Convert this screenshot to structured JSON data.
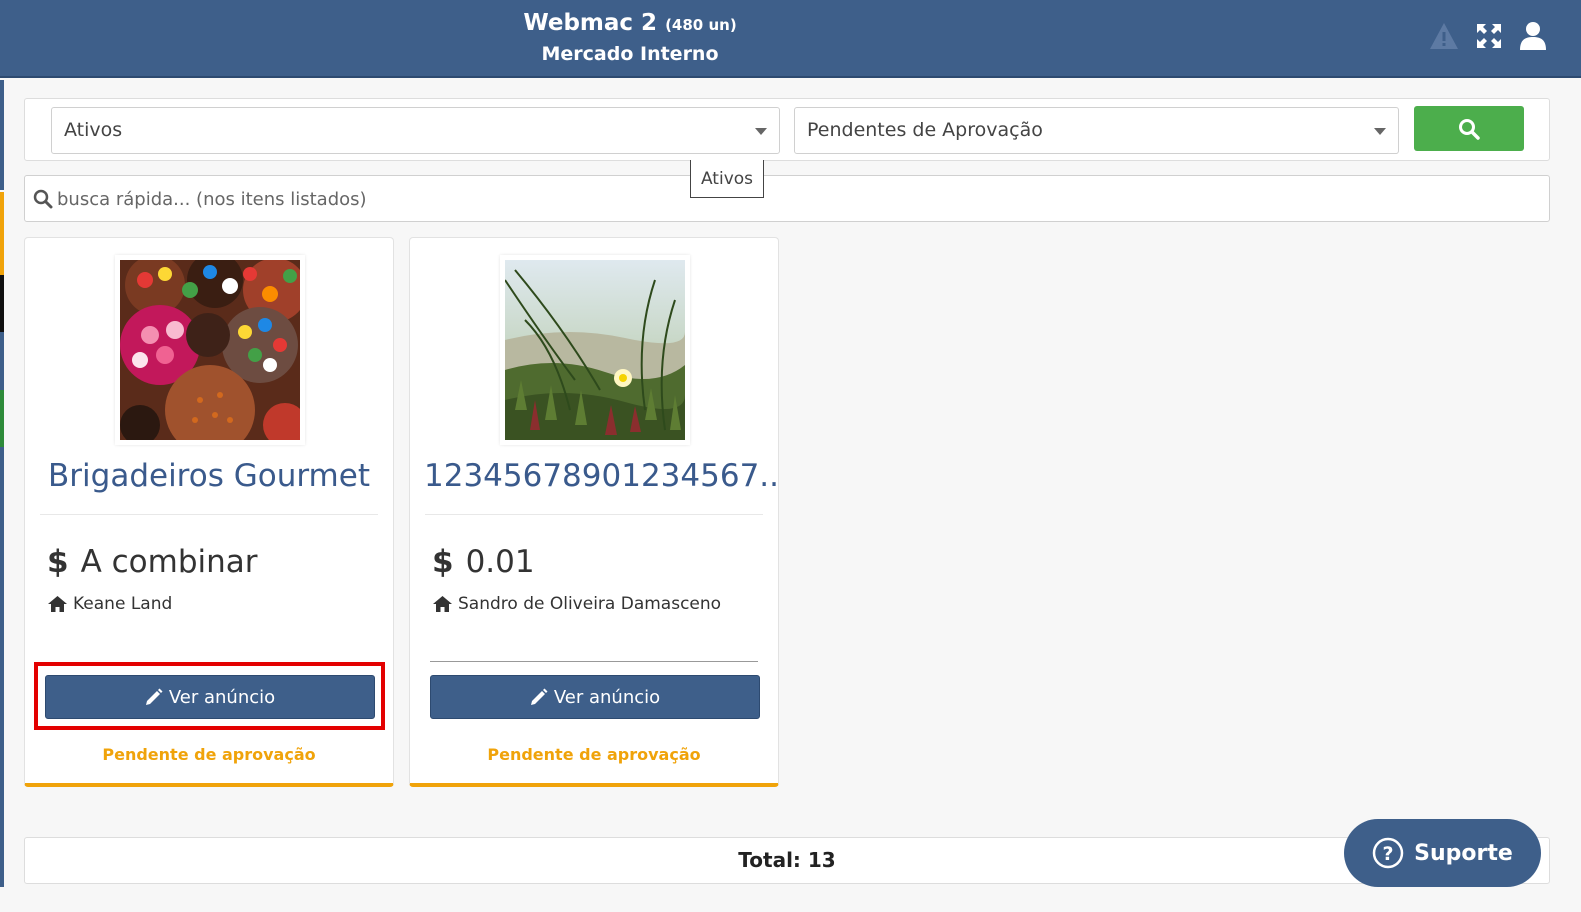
{
  "header": {
    "title": "Webmac 2",
    "count": "(480 un)",
    "subtitle": "Mercado Interno",
    "icons": [
      "warning-icon",
      "expand-icon",
      "user-icon"
    ]
  },
  "filters": {
    "status_select": "Ativos",
    "approval_select": "Pendentes de Aprovação",
    "search_button_icon": "search-icon"
  },
  "tooltip": "Ativos",
  "quicksearch": {
    "placeholder": "busca rápida... (nos itens listados)"
  },
  "cards": [
    {
      "name": "Brigadeiros Gourmet",
      "currency": "$",
      "price": "A combinar",
      "seller": "Keane Land",
      "button_label": "Ver anúncio",
      "status": "Pendente de aprovação"
    },
    {
      "name": "12345678901234567...",
      "currency": "$",
      "price": "0.01",
      "seller": "Sandro de Oliveira Damasceno",
      "button_label": "Ver anúncio",
      "status": "Pendente de aprovação"
    }
  ],
  "total": "Total: 13",
  "support_label": "Suporte",
  "colors": {
    "header": "#3e5f8a",
    "accent_orange": "#f0a30a",
    "search_green": "#4cae4c",
    "highlight_red": "#e30000"
  }
}
